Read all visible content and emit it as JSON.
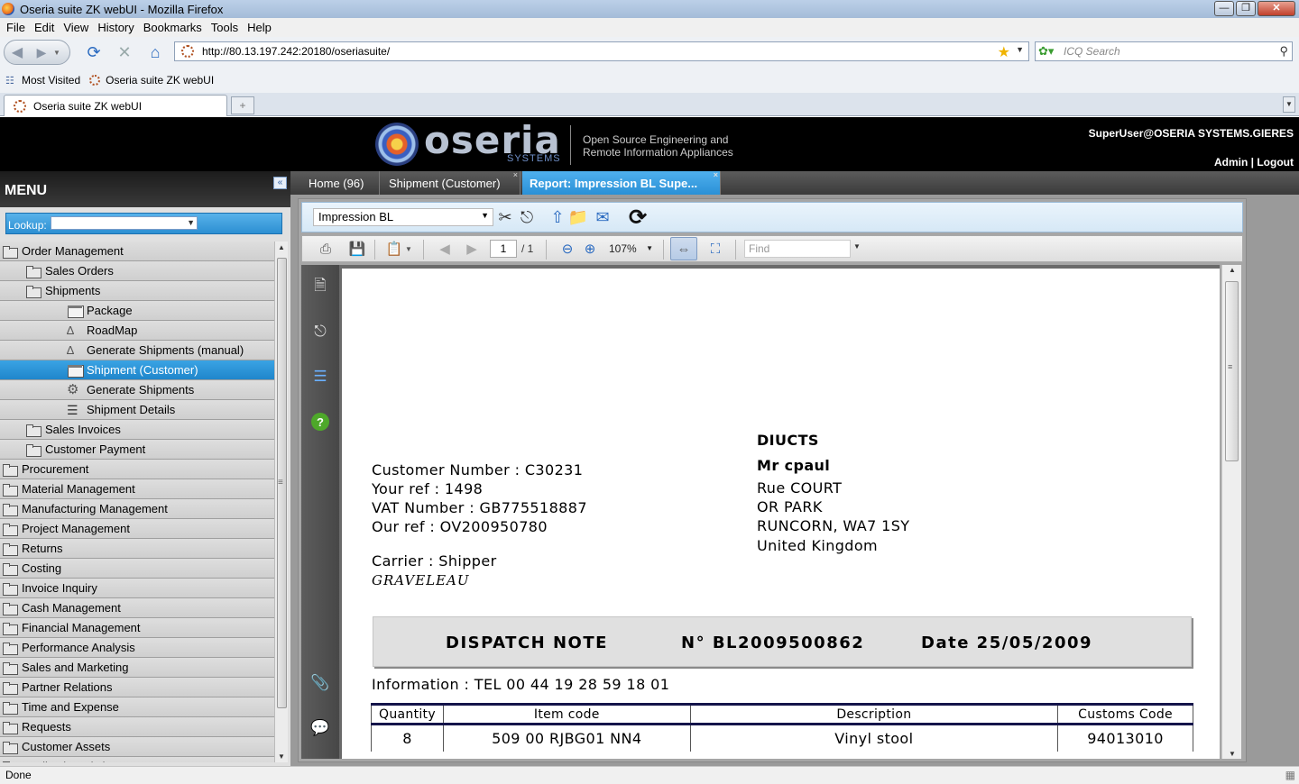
{
  "browser": {
    "window_title": "Oseria suite ZK webUI - Mozilla Firefox",
    "menus": [
      "File",
      "Edit",
      "View",
      "History",
      "Bookmarks",
      "Tools",
      "Help"
    ],
    "url": "http://80.13.197.242:20180/oseriasuite/",
    "search_placeholder": "ICQ Search",
    "bookmarks": [
      "Most Visited",
      "Oseria suite ZK webUI"
    ],
    "tab_title": "Oseria suite ZK webUI",
    "status_text": "Done"
  },
  "header": {
    "logo_text": "oseria",
    "logo_subtext": "SYSTEMS",
    "tagline_line1": "Open Source Engineering and",
    "tagline_line2": "Remote Information Appliances",
    "user": "SuperUser@OSERIA SYSTEMS.GIERES",
    "admin_link": "Admin",
    "separator": "|",
    "logout_link": "Logout"
  },
  "menu": {
    "title": "MENU",
    "lookup_label": "Lookup:",
    "lookup_value": "",
    "items": [
      {
        "label": "Order Management",
        "level": 0,
        "icon": "folder-open-icon"
      },
      {
        "label": "Sales Orders",
        "level": 1,
        "icon": "folder-icon"
      },
      {
        "label": "Shipments",
        "level": 1,
        "icon": "folder-open-icon"
      },
      {
        "label": "Package",
        "level": 2,
        "icon": "window-icon"
      },
      {
        "label": "RoadMap",
        "level": 2,
        "icon": "workflow-icon"
      },
      {
        "label": "Generate Shipments (manual)",
        "level": 2,
        "icon": "workflow-icon"
      },
      {
        "label": "Shipment (Customer)",
        "level": 2,
        "icon": "window-icon",
        "selected": true
      },
      {
        "label": "Generate Shipments",
        "level": 2,
        "icon": "gear-icon"
      },
      {
        "label": "Shipment Details",
        "level": 2,
        "icon": "list-icon"
      },
      {
        "label": "Sales Invoices",
        "level": 1,
        "icon": "folder-icon"
      },
      {
        "label": "Customer Payment",
        "level": 1,
        "icon": "folder-icon"
      },
      {
        "label": "Procurement",
        "level": 0,
        "icon": "folder-icon"
      },
      {
        "label": "Material Management",
        "level": 0,
        "icon": "folder-icon"
      },
      {
        "label": "Manufacturing Management",
        "level": 0,
        "icon": "folder-icon"
      },
      {
        "label": "Project Management",
        "level": 0,
        "icon": "folder-icon"
      },
      {
        "label": "Returns",
        "level": 0,
        "icon": "folder-icon"
      },
      {
        "label": "Costing",
        "level": 0,
        "icon": "folder-icon"
      },
      {
        "label": "Invoice Inquiry",
        "level": 0,
        "icon": "folder-icon"
      },
      {
        "label": "Cash Management",
        "level": 0,
        "icon": "folder-icon"
      },
      {
        "label": "Financial Management",
        "level": 0,
        "icon": "folder-icon"
      },
      {
        "label": "Performance Analysis",
        "level": 0,
        "icon": "folder-icon"
      },
      {
        "label": "Sales and Marketing",
        "level": 0,
        "icon": "folder-icon"
      },
      {
        "label": "Partner Relations",
        "level": 0,
        "icon": "folder-icon"
      },
      {
        "label": "Time and Expense",
        "level": 0,
        "icon": "folder-icon"
      },
      {
        "label": "Requests",
        "level": 0,
        "icon": "folder-icon"
      },
      {
        "label": "Customer Assets",
        "level": 0,
        "icon": "folder-icon"
      },
      {
        "label": "Application Dictionary",
        "level": 0,
        "icon": "folder-icon"
      }
    ]
  },
  "content_tabs": [
    {
      "label": "Home (96)",
      "active": false,
      "closable": false
    },
    {
      "label": "Shipment (Customer)",
      "active": false,
      "closable": true
    },
    {
      "label": "Report: Impression BL Supe...",
      "active": true,
      "closable": true
    }
  ],
  "report": {
    "selected_format": "Impression BL",
    "page_current": "1",
    "page_total": "/ 1",
    "zoom": "107%",
    "find_placeholder": "Find"
  },
  "document": {
    "customer_number": "Customer Number : C30231",
    "your_ref": "Your ref : 1498",
    "vat_number": "VAT Number : GB775518887",
    "our_ref": "Our ref : OV200950780",
    "carrier": "Carrier : Shipper",
    "carrier_name": "GRAVELEAU",
    "recipient_company": "DIUCTS",
    "recipient_contact": "Mr  cpaul",
    "address_line1": "Rue COURT",
    "address_line2": "OR PARK",
    "address_line3": "RUNCORN,  WA7 1SY",
    "address_country": "United Kingdom",
    "dispatch_title": "DISPATCH NOTE",
    "dispatch_number": "N° BL2009500862",
    "dispatch_date": "Date 25/05/2009",
    "information": "Information : TEL 00 44 19 28 59 18 01",
    "table_headers": [
      "Quantity",
      "Item code",
      "Description",
      "Customs Code"
    ],
    "table_rows": [
      [
        "8",
        "509 00 RJBG01 NN4",
        "Vinyl stool",
        "94013010"
      ]
    ]
  }
}
